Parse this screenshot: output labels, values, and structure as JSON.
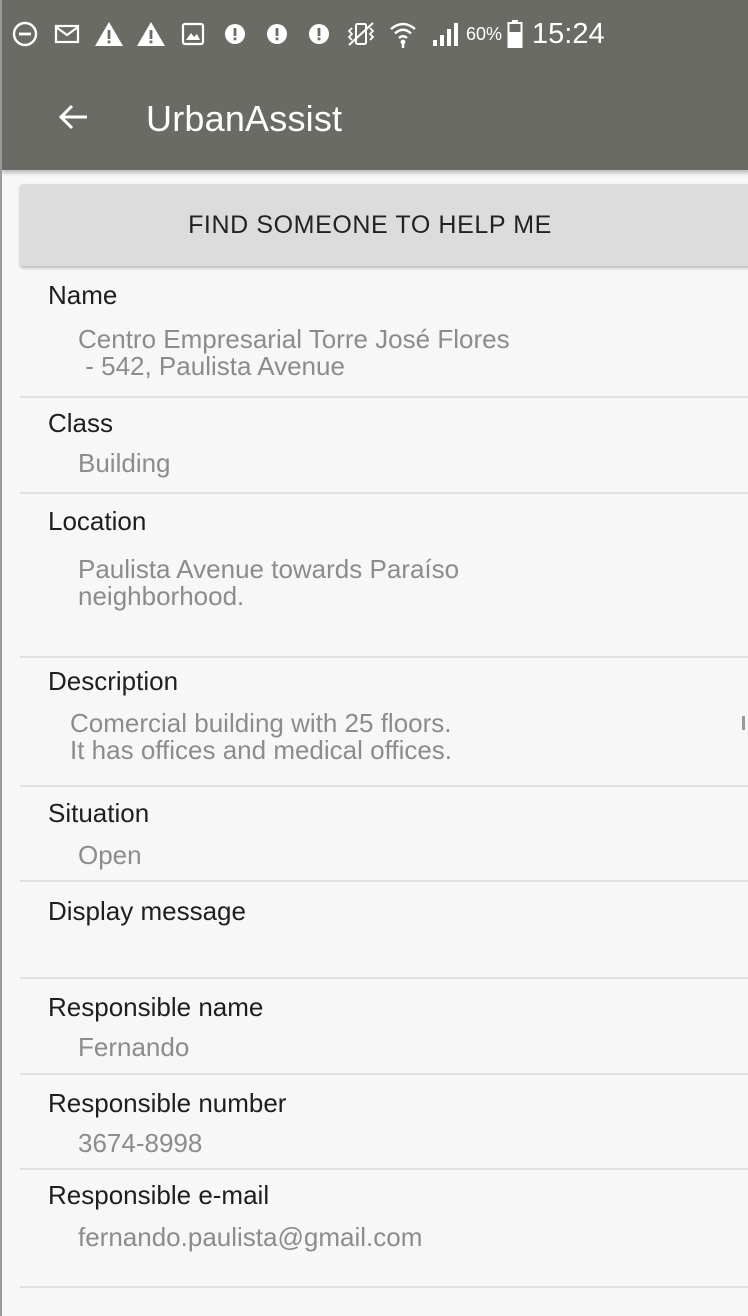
{
  "status_bar": {
    "icons": [
      "minus-circle-icon",
      "mail-icon",
      "warning-icon",
      "warning-icon",
      "image-icon",
      "alert-circle-icon",
      "alert-circle-icon",
      "alert-circle-icon",
      "vibrate-icon",
      "wifi-icon",
      "signal-icon"
    ],
    "battery_percent": "60%",
    "time": "15:24"
  },
  "app_bar": {
    "back_icon": "arrow-back-icon",
    "title": "UrbanAssist"
  },
  "actions": {
    "find_help_label": "FIND SOMEONE TO HELP ME"
  },
  "fields": {
    "name": {
      "label": "Name",
      "value": "Centro Empresarial Torre José Flores\n - 542, Paulista Avenue"
    },
    "class": {
      "label": "Class",
      "value": "Building"
    },
    "location": {
      "label": "Location",
      "value": "Paulista Avenue towards Paraíso\nneighborhood."
    },
    "description": {
      "label": "Description",
      "value": "Comercial building with 25 floors.\nIt has offices and medical offices."
    },
    "situation": {
      "label": "Situation",
      "value": "Open"
    },
    "display_message": {
      "label": "Display message",
      "value": ""
    },
    "responsible_name": {
      "label": "Responsible name",
      "value": "Fernando"
    },
    "responsible_number": {
      "label": "Responsible number",
      "value": "3674-8998"
    },
    "responsible_email": {
      "label": "Responsible e-mail",
      "value": "fernando.paulista@gmail.com"
    }
  },
  "colors": {
    "app_bar": "#6b6b66",
    "background": "#f7f7f7",
    "button": "#dcdcdc",
    "label_text": "#1e1e1e",
    "value_text": "#8c8c8c"
  }
}
